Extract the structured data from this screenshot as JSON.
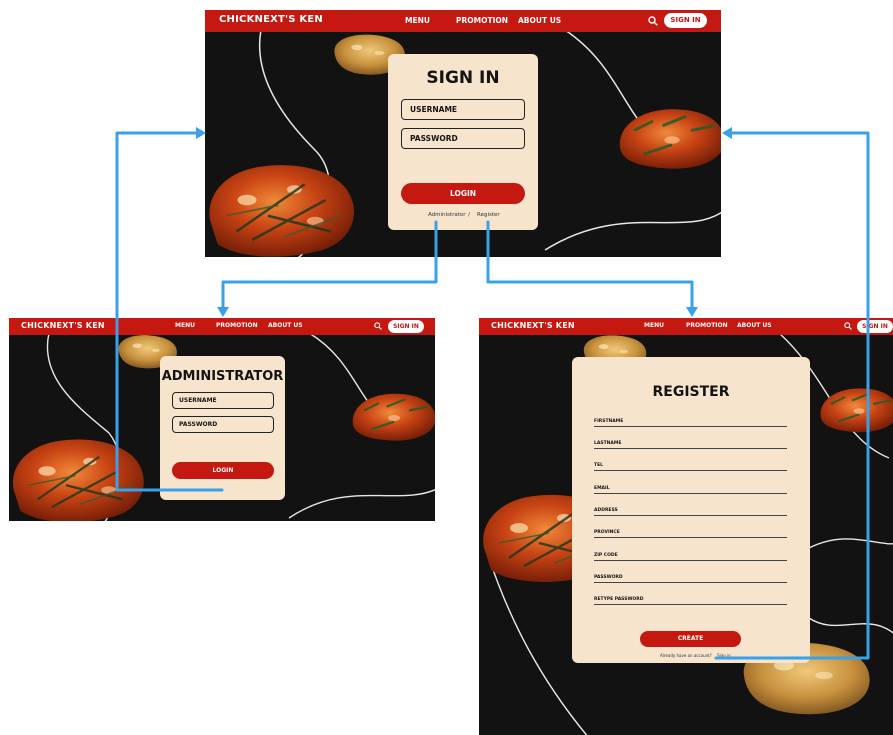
{
  "nav": {
    "brand": "CHICKNEXT'S KEN",
    "menu": "MENU",
    "promotion": "PROMOTION",
    "about": "ABOUT US",
    "sign_in": "SIGN IN",
    "search_icon": "search-icon"
  },
  "signin_page": {
    "title": "SIGN IN",
    "username": "USERNAME",
    "password": "PASSWORD",
    "login": "LOGIN",
    "admin_link": "Administrator",
    "separator": "/",
    "register_link": "Register"
  },
  "admin_page": {
    "title": "ADMINISTRATOR",
    "username": "USERNAME",
    "password": "PASSWORD",
    "login": "LOGIN"
  },
  "register_page": {
    "title": "REGISTER",
    "fields": [
      "FIRSTNAME",
      "LASTNAME",
      "TEL",
      "EMAIL",
      "ADDRESS",
      "PROVINCE",
      "ZIP CODE",
      "PASSWORD",
      "RETYPE PASSWORD"
    ],
    "create": "CREATE",
    "already": "Already have an account?",
    "sign_in_link": "Sign in"
  },
  "colors": {
    "brand_red": "#c41810",
    "card": "#f7e4cc",
    "background": "#121212",
    "flow_arrow": "#3aa0e8"
  }
}
